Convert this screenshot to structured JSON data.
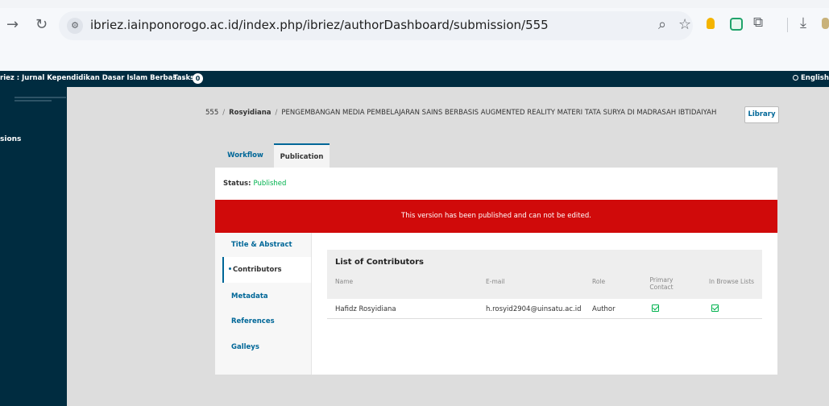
{
  "browser": {
    "back_icon": "arrow-right-icon",
    "reload_icon": "reload-icon",
    "url": "ibriez.iainponorogo.ac.id/index.php/ibriez/authorDashboard/submission/555"
  },
  "topbar": {
    "journal_title": "riez : Jurnal Kependidikan Dasar Islam Berbas...",
    "tasks_label": "Tasks",
    "tasks_count": "0",
    "language": "English"
  },
  "sidebar": {
    "nav_label": "sions"
  },
  "breadcrumb": {
    "id": "555",
    "separator": "/",
    "author": "Rosyidiana",
    "title": "PENGEMBANGAN MEDIA PEMBELAJARAN SAINS BERBASIS AUGMENTED REALITY MATERI TATA SURYA DI MADRASAH IBTIDAIYAH"
  },
  "library_label": "Library",
  "tabs": [
    {
      "label": "Workflow"
    },
    {
      "label": "Publication"
    }
  ],
  "status": {
    "label": "Status:",
    "value": "Published"
  },
  "alert_text": "This version has been published and can not be edited.",
  "subnav": [
    {
      "label": "Title & Abstract"
    },
    {
      "label": "Contributors"
    },
    {
      "label": "Metadata"
    },
    {
      "label": "References"
    },
    {
      "label": "Galleys"
    }
  ],
  "contributors": {
    "title": "List of Contributors",
    "columns": [
      "Name",
      "E-mail",
      "Role",
      "Primary Contact",
      "In Browse Lists"
    ],
    "rows": [
      {
        "name": "Hafidz Rosyidiana",
        "email": "h.rosyid2904@uinsatu.ac.id",
        "role": "Author",
        "primary_contact": true,
        "in_browse_lists": true
      }
    ]
  },
  "colors": {
    "brand_dark": "#002c40",
    "link_blue": "#006798",
    "alert_red": "#d00a0a",
    "success_green": "#00b24e"
  }
}
